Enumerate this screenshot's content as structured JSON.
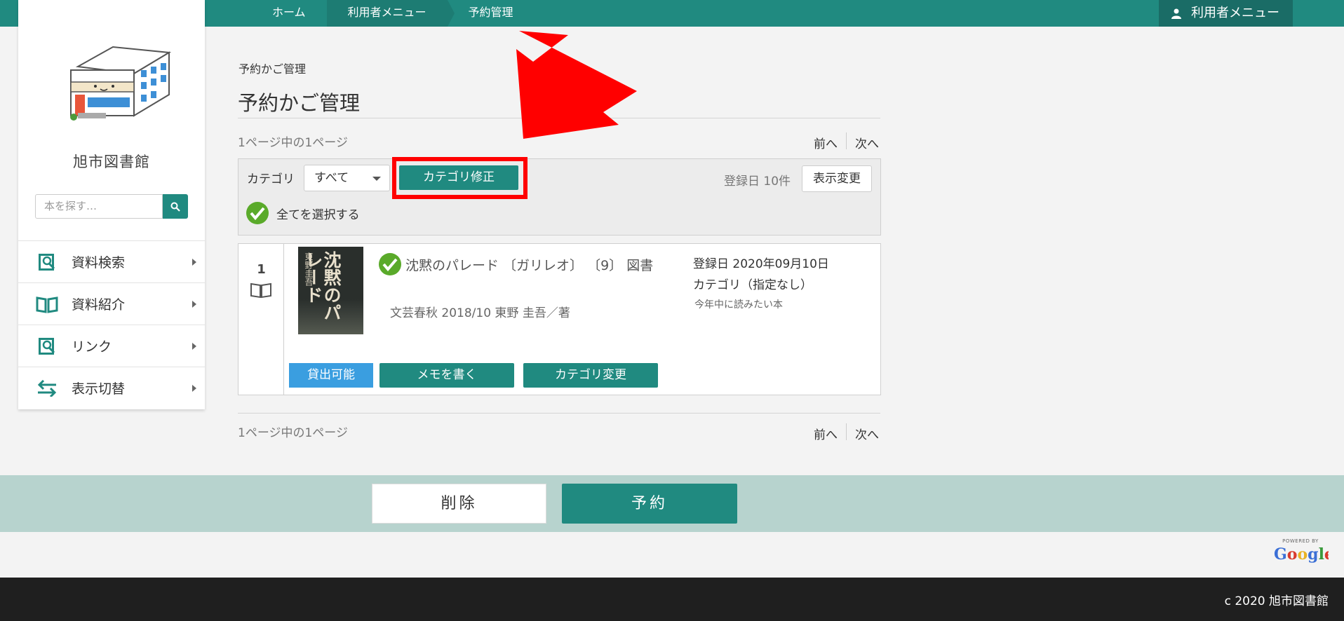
{
  "topbar": {
    "breadcrumbs": [
      "ホーム",
      "利用者メニュー",
      "予約管理"
    ],
    "user_menu": "利用者メニュー"
  },
  "sidebar": {
    "library_name": "旭市図書館",
    "search_placeholder": "本を探す…",
    "items": [
      {
        "label": "資料検索",
        "icon": "search-book-icon"
      },
      {
        "label": "資料紹介",
        "icon": "open-book-icon"
      },
      {
        "label": "リンク",
        "icon": "search-book-icon"
      },
      {
        "label": "表示切替",
        "icon": "swap-arrows-icon"
      }
    ]
  },
  "main": {
    "small_title": "予約かご管理",
    "title": "予約かご管理",
    "page_info": "1ページ中の1ページ",
    "pager": {
      "prev": "前へ",
      "next": "次へ"
    },
    "filter": {
      "category_label": "カテゴリ",
      "category_value": "すべて",
      "category_fix_button": "カテゴリ修正",
      "sort_info": "登録日 10件",
      "view_change_button": "表示変更",
      "select_all": "全てを選択する"
    },
    "items": [
      {
        "number": "1",
        "cover_title": "沈黙のパレード",
        "cover_author": "東野圭吾",
        "title": "沈黙のパレード 〔ガリレオ〕 〔9〕 図書",
        "publisher_line": "文芸春秋 2018/10 東野 圭吾／著",
        "registered": "登録日 2020年09月10日",
        "category": "カテゴリ（指定なし）",
        "memo": "今年中に読みたい本",
        "status": "貸出可能",
        "memo_button": "メモを書く",
        "category_change_button": "カテゴリ変更"
      }
    ]
  },
  "actions": {
    "delete": "削除",
    "reserve": "予約"
  },
  "powered_by": "POWERED BY",
  "google_logo": "Google",
  "footer": {
    "copyright": "c 2020 旭市図書館"
  },
  "colors": {
    "primary": "#208a80",
    "band": "#b7d3ce",
    "available": "#3a9ee0",
    "highlight": "#ff0000",
    "footer": "#1f1f1f"
  }
}
